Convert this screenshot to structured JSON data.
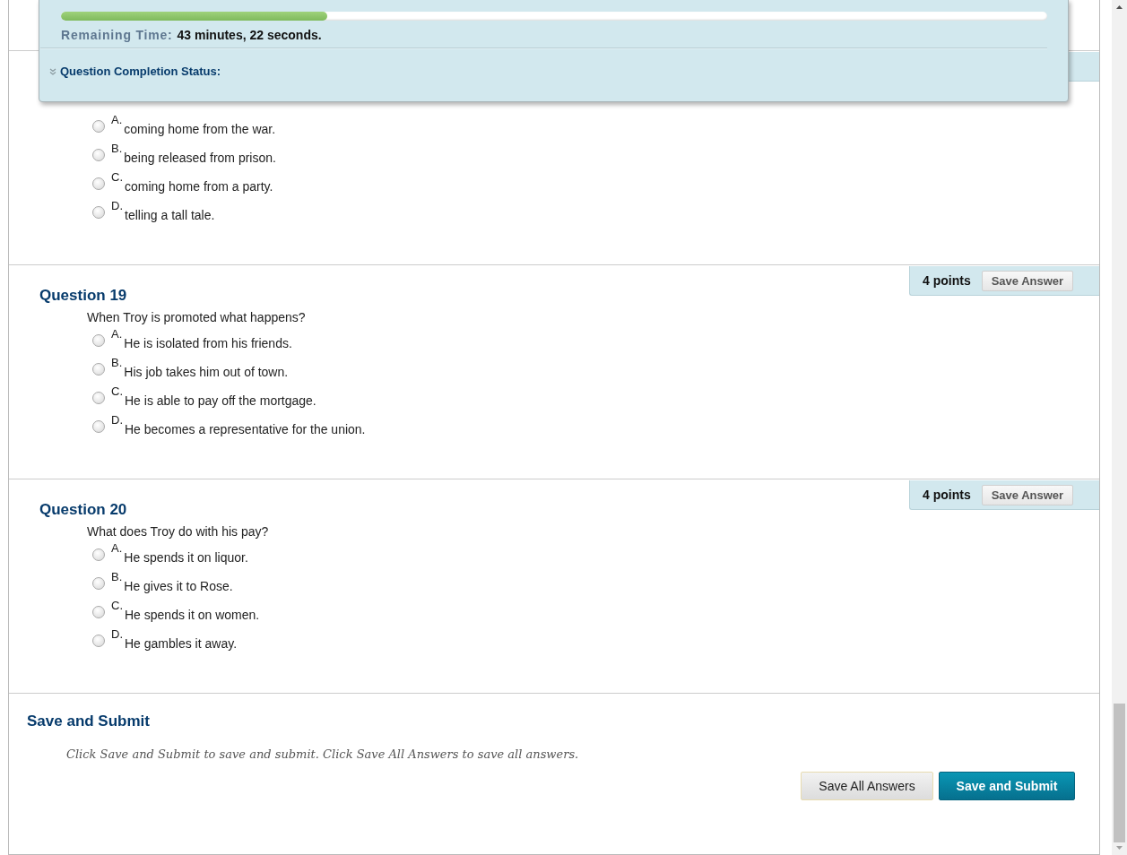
{
  "timer": {
    "level": 0.27,
    "label": "Remaining Time:",
    "value": "43 minutes, 22 seconds.",
    "status": {
      "label": "Question Completion Status:",
      "expanded": false
    }
  },
  "questions": [
    {
      "choices": [
        {
          "letter": "A.",
          "text": "coming home from the war.",
          "selected": false
        },
        {
          "letter": "B.",
          "text": "being released from prison.",
          "selected": false
        },
        {
          "letter": "C.",
          "text": "coming home from a party.",
          "selected": false
        },
        {
          "letter": "D.",
          "text": "telling a tall tale.",
          "selected": false
        }
      ]
    },
    {
      "title": "Question 19",
      "points": "4 points",
      "save": "Save Answer",
      "prompt": "When Troy is promoted what happens?",
      "choices": [
        {
          "letter": "A.",
          "text": "He is isolated from his friends.",
          "selected": false
        },
        {
          "letter": "B.",
          "text": "His job takes him out of town.",
          "selected": false
        },
        {
          "letter": "C.",
          "text": "He is able to pay off the mortgage.",
          "selected": false
        },
        {
          "letter": "D.",
          "text": "He becomes a representative for the union.",
          "selected": false
        }
      ]
    },
    {
      "title": "Question 20",
      "points": "4 points",
      "save": "Save Answer",
      "prompt": "What does Troy do with his pay?",
      "choices": [
        {
          "letter": "A.",
          "text": "He spends it on liquor.",
          "selected": false
        },
        {
          "letter": "B.",
          "text": "He gives it to Rose.",
          "selected": false
        },
        {
          "letter": "C.",
          "text": "He spends it on women.",
          "selected": false
        },
        {
          "letter": "D.",
          "text": "He gambles it away.",
          "selected": false
        }
      ]
    }
  ],
  "submit": {
    "title": "Save and Submit",
    "instructions": "Click Save and Submit to save and submit. Click Save All Answers to save all answers.",
    "buttons": [
      {
        "label": "Save All Answers",
        "kind": "secondary"
      },
      {
        "label": "Save and Submit",
        "kind": "primary"
      }
    ]
  }
}
